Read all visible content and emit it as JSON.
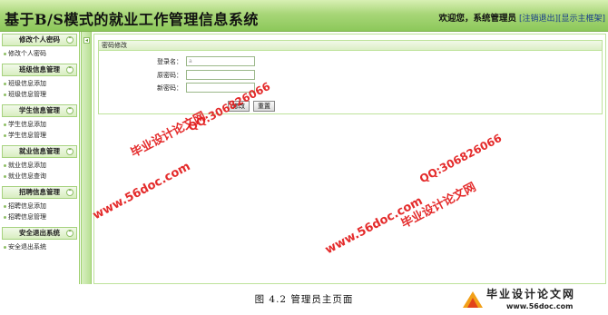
{
  "header": {
    "title": "基于B/S模式的就业工作管理信息系统",
    "welcome": "欢迎您，系统管理员",
    "logout": "[注销退出]",
    "sitemap": "[显示主框架]"
  },
  "sidebar": {
    "menus": [
      {
        "title": "修改个人密码",
        "items": [
          "修改个人密码"
        ]
      },
      {
        "title": "班级信息管理",
        "items": [
          "班级信息添加",
          "班级信息管理"
        ]
      },
      {
        "title": "学生信息管理",
        "items": [
          "学生信息添加",
          "学生信息管理"
        ]
      },
      {
        "title": "就业信息管理",
        "items": [
          "就业信息添加",
          "就业信息查询"
        ]
      },
      {
        "title": "招聘信息管理",
        "items": [
          "招聘信息添加",
          "招聘信息管理"
        ]
      },
      {
        "title": "安全退出系统",
        "items": [
          "安全退出系统"
        ]
      }
    ]
  },
  "form": {
    "panel_title": "密码修改",
    "username_label": "登录名：",
    "username_value": "a",
    "old_password_label": "原密码：",
    "new_password_label": "新密码：",
    "submit": "修改",
    "reset": "重置"
  },
  "caption": "图 4.2 管理员主页面",
  "watermarks": {
    "site_name": "毕业设计论文网",
    "url": "www.56doc.com",
    "qq": "QQ:306826066"
  },
  "logo": {
    "name": "毕业设计论文网",
    "url": "www.56doc.com"
  },
  "colors": {
    "accent_green": "#8cc85a",
    "watermark_red": "#e21a1a"
  }
}
